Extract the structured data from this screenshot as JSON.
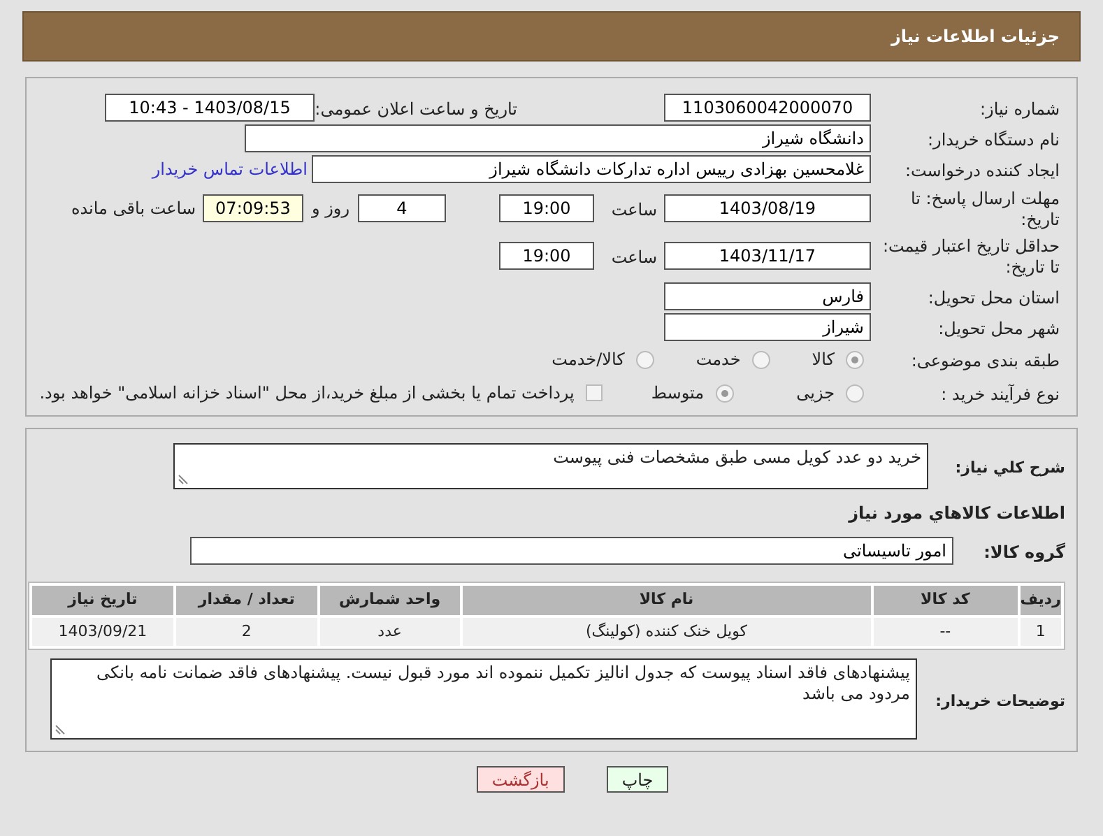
{
  "header": {
    "title": "جزئیات اطلاعات نیاز"
  },
  "fields": {
    "need_number": {
      "label": "شماره نیاز:",
      "value": "1103060042000070"
    },
    "announce": {
      "label": "تاریخ و ساعت اعلان عمومی:",
      "value": "1403/08/15 - 10:43"
    },
    "buyer_org": {
      "label": "نام دستگاه خریدار:",
      "value": "دانشگاه شیراز"
    },
    "requester": {
      "label": "ایجاد کننده درخواست:",
      "value": "غلامحسین بهزادی رییس اداره تدارکات دانشگاه شیراز",
      "link": "اطلاعات تماس خریدار"
    },
    "reply_deadline": {
      "label": "مهلت ارسال پاسخ: تا تاریخ:",
      "date": "1403/08/19",
      "time_label": "ساعت",
      "time": "19:00",
      "days": "4",
      "days_label": "روز و",
      "remaining": "07:09:53",
      "remaining_label": "ساعت باقی مانده"
    },
    "price_validity": {
      "label": "حداقل تاریخ اعتبار قیمت: تا تاریخ:",
      "date": "1403/11/17",
      "time_label": "ساعت",
      "time": "19:00"
    },
    "province": {
      "label": "استان محل تحویل:",
      "value": "فارس"
    },
    "city": {
      "label": "شهر محل تحویل:",
      "value": "شیراز"
    },
    "category": {
      "label": "طبقه بندی موضوعی:",
      "options": [
        {
          "label": "کالا",
          "selected": true
        },
        {
          "label": "خدمت",
          "selected": false
        },
        {
          "label": "کالا/خدمت",
          "selected": false
        }
      ]
    },
    "process": {
      "label": "نوع فرآیند خرید :",
      "options": [
        {
          "label": "جزیی",
          "selected": false
        },
        {
          "label": "متوسط",
          "selected": true
        }
      ],
      "payment_note": {
        "label": "پرداخت تمام یا بخشی از مبلغ خرید،از محل \"اسناد خزانه اسلامی\" خواهد بود.",
        "checked": false
      }
    }
  },
  "description": {
    "label": "شرح کلي نياز:",
    "value": "خرید دو عدد کویل مسی طبق مشخصات فنی پیوست"
  },
  "goods_section": {
    "title": "اطلاعات کالاهاي مورد نياز",
    "group_label": "گروه کالا:",
    "group_value": "امور تاسیساتی",
    "table": {
      "columns": [
        "ردیف",
        "کد کالا",
        "نام کالا",
        "واحد شمارش",
        "تعداد / مقدار",
        "تاریخ نیاز"
      ],
      "rows": [
        [
          "1",
          "--",
          "کویل خنک کننده (کولینگ)",
          "عدد",
          "2",
          "1403/09/21"
        ]
      ]
    }
  },
  "buyer_notes": {
    "label": "توضیحات خریدار:",
    "value": "پیشنهادهای فاقد اسناد پیوست که جدول انالیز تکمیل ننموده اند مورد قبول نیست. پیشنهادهای فاقد ضمانت نامه بانکی مردود می باشد"
  },
  "buttons": [
    {
      "label": "چاپ",
      "kind": "print"
    },
    {
      "label": "بازگشت",
      "kind": "back"
    }
  ]
}
